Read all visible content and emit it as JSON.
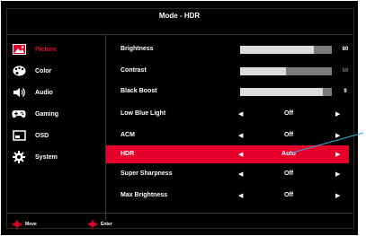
{
  "title": "Mode - HDR",
  "sidebar": {
    "items": [
      {
        "label": "Picture",
        "icon": "picture-icon"
      },
      {
        "label": "Color",
        "icon": "palette-icon"
      },
      {
        "label": "Audio",
        "icon": "speaker-icon"
      },
      {
        "label": "Gaming",
        "icon": "gamepad-icon"
      },
      {
        "label": "OSD",
        "icon": "osd-window-icon"
      },
      {
        "label": "System",
        "icon": "gear-icon"
      }
    ]
  },
  "settings": [
    {
      "label": "Brightness",
      "type": "slider",
      "value": "80",
      "level": 0.8
    },
    {
      "label": "Contrast",
      "type": "slider",
      "value": "50",
      "level": 0.5
    },
    {
      "label": "Black Boost",
      "type": "slider",
      "value": "9",
      "level": 0.9
    },
    {
      "label": "Low Blue Light",
      "type": "option",
      "value": "Off"
    },
    {
      "label": "ACM",
      "type": "option",
      "value": "Off"
    },
    {
      "label": "HDR",
      "type": "option",
      "value": "Auto"
    },
    {
      "label": "Super Sharpness",
      "type": "option",
      "value": "Off"
    },
    {
      "label": "Max Brightness",
      "type": "option",
      "value": "Off"
    }
  ],
  "footer": {
    "move": "Move",
    "enter": "Enter"
  },
  "colors": {
    "accent": "#e4002b",
    "background": "#000000",
    "slider_track": "#7b7b7b",
    "slider_fill": "#dcdcdc"
  }
}
